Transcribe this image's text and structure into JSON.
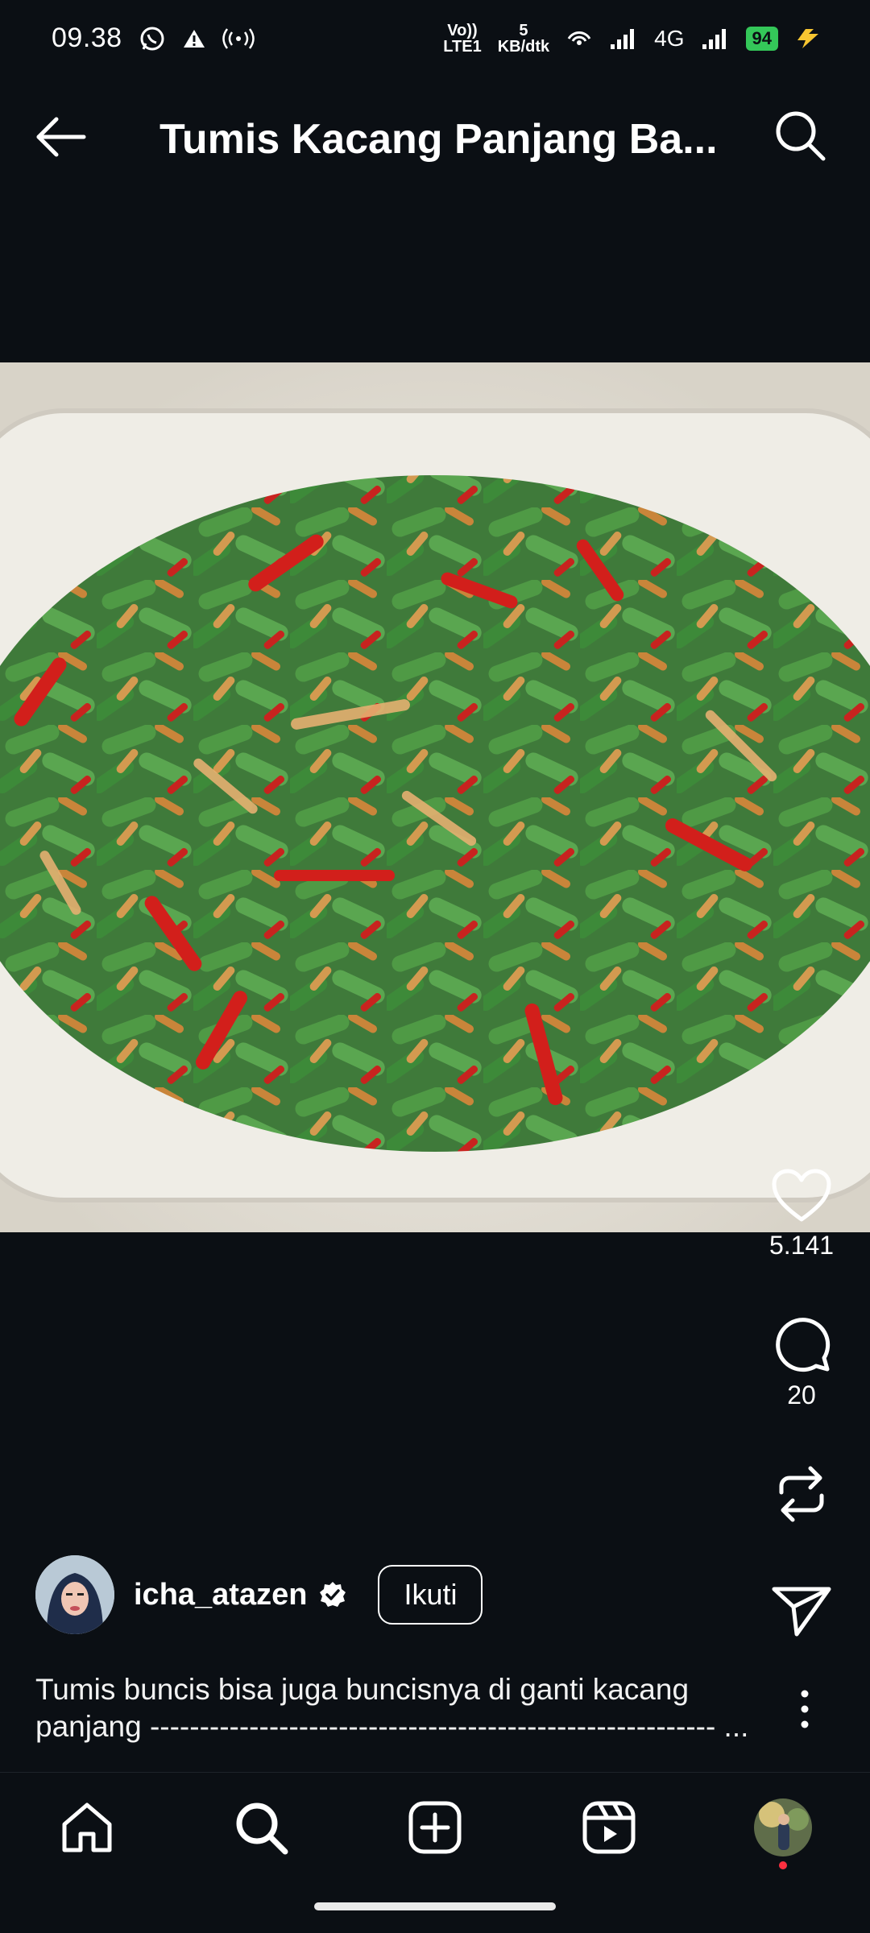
{
  "status_bar": {
    "time": "09.38",
    "network_top": "5",
    "network_bottom": "KB/dtk",
    "volte_top": "Vo))",
    "volte_bottom": "LTE1",
    "signal_label": "4G",
    "battery": "94"
  },
  "header": {
    "title": "Tumis Kacang Panjang Ba..."
  },
  "post": {
    "image_alt": "Stir-fried green beans with red chili and shallots in a white dish",
    "likes": "5.141",
    "comments": "20",
    "username": "icha_atazen",
    "follow_label": "Ikuti",
    "caption_line1": "Tumis buncis bisa juga buncisnya di ganti kacang",
    "caption_line2": "panjang --------------------------------------------------------- ..."
  },
  "colors": {
    "background": "#0b0f14",
    "battery_green": "#34c759",
    "notification_red": "#ff3040"
  },
  "icons": [
    "whatsapp-icon",
    "warning-icon",
    "hotspot-icon",
    "wifi-icon",
    "signal-icon",
    "back-arrow-icon",
    "search-icon",
    "heart-icon",
    "comment-icon",
    "repost-icon",
    "share-icon",
    "more-icon",
    "home-icon",
    "explore-icon",
    "create-icon",
    "reels-icon",
    "profile-icon",
    "verified-icon"
  ]
}
